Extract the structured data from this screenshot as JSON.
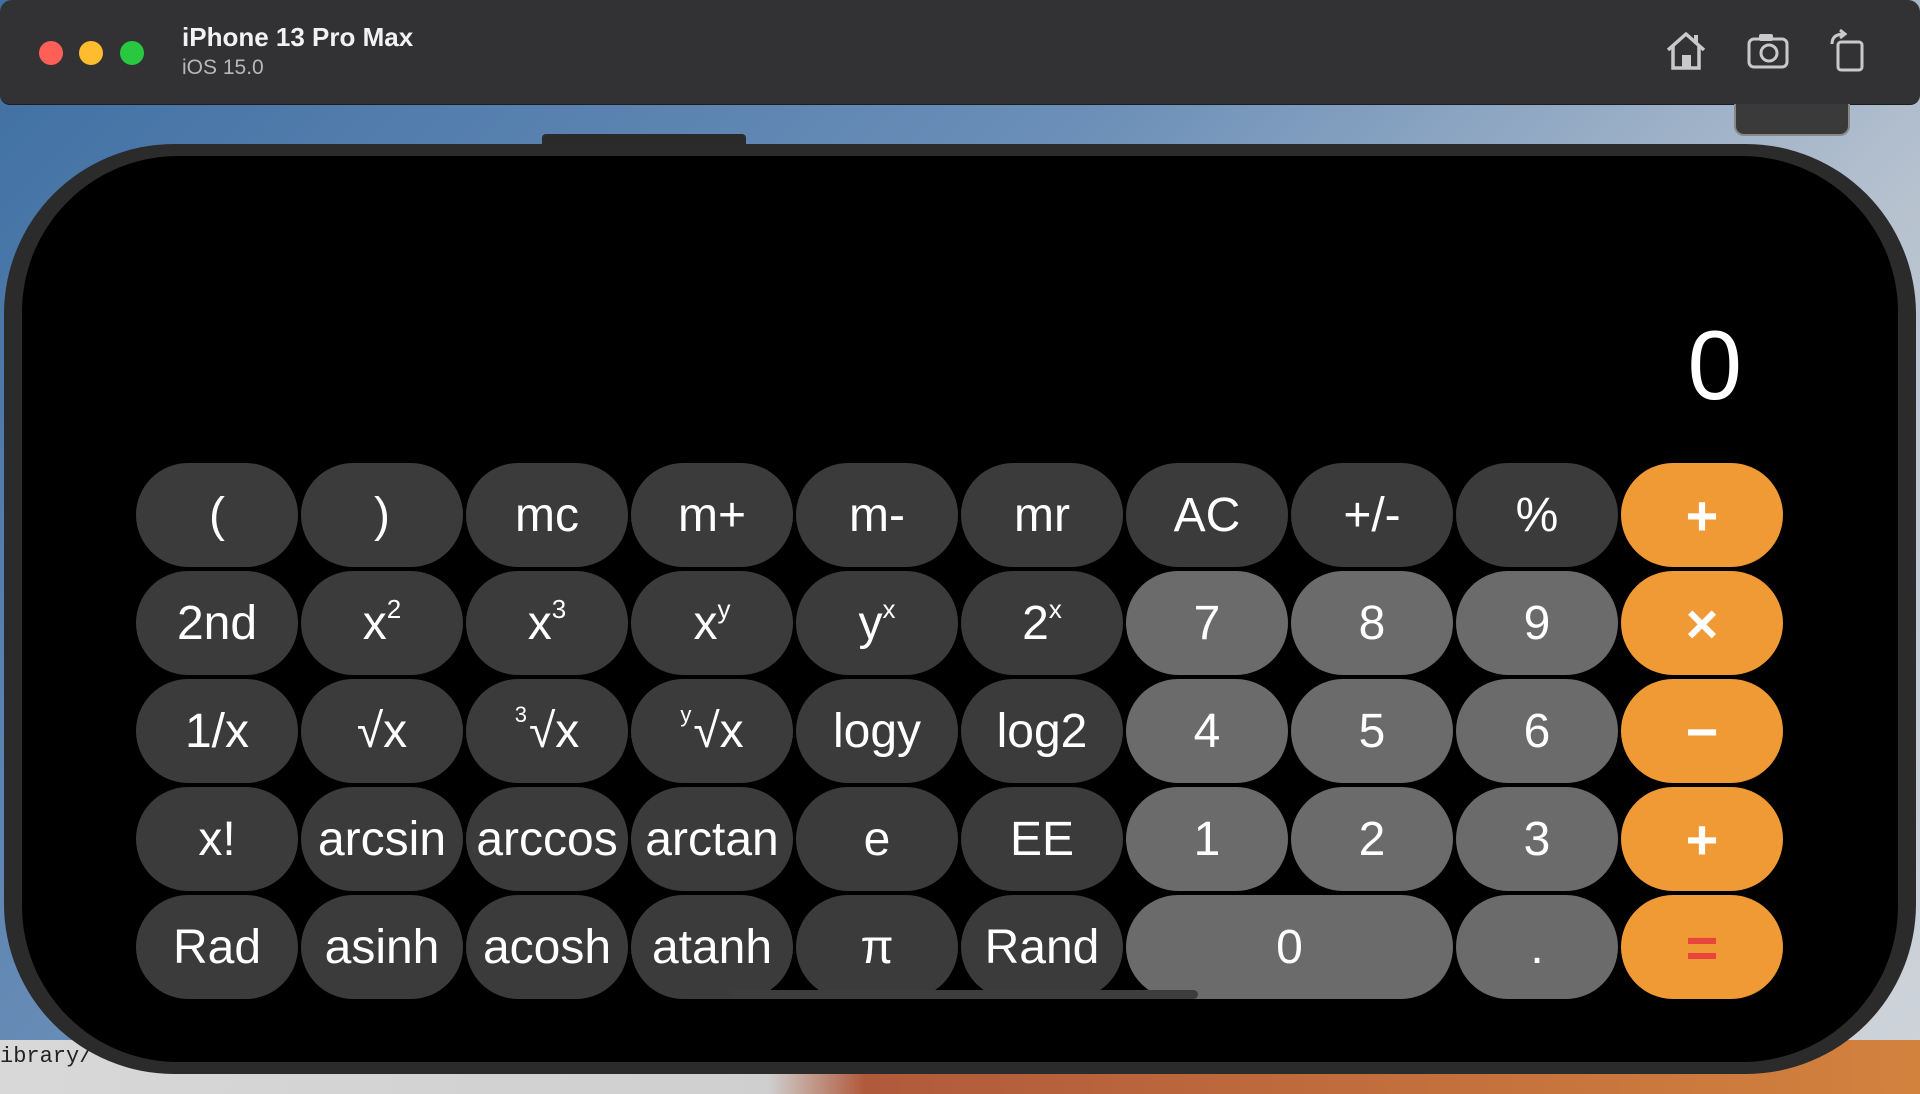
{
  "window": {
    "title": "iPhone 13 Pro Max",
    "subtitle": "iOS 15.0",
    "icons": [
      "home-icon",
      "screenshot-icon",
      "rotate-icon"
    ]
  },
  "background": {
    "terminal_text": "ibrary/"
  },
  "calculator": {
    "display": "0",
    "rows": [
      [
        "(",
        ")",
        "mc",
        "m+",
        "m-",
        "mr",
        "AC",
        "+/-",
        "%",
        "÷"
      ],
      [
        "2nd",
        "x²",
        "x³",
        "xʸ",
        "yˣ",
        "2ˣ",
        "7",
        "8",
        "9",
        "×"
      ],
      [
        "1/x",
        "√x",
        "∛x",
        "ʸ√x",
        "logy",
        "log2",
        "4",
        "5",
        "6",
        "−"
      ],
      [
        "x!",
        "arcsin",
        "arccos",
        "arctan",
        "e",
        "EE",
        "1",
        "2",
        "3",
        "+"
      ],
      [
        "Rad",
        "asinh",
        "acosh",
        "atanh",
        "π",
        "Rand",
        "0",
        ".",
        "="
      ]
    ],
    "keys": {
      "r0": [
        "(",
        ")",
        "mc",
        "m+",
        "m-",
        "mr",
        "AC",
        "+/-",
        "%",
        "+"
      ],
      "r1_base": [
        "2nd",
        "x",
        "x",
        "x",
        "y",
        "2",
        "7",
        "8",
        "9",
        "×"
      ],
      "r1_sup": [
        "",
        "2",
        "3",
        "y",
        "x",
        "x"
      ],
      "r2": [
        "1/x",
        "√x",
        "√x",
        "√x",
        "logy",
        "log2",
        "4",
        "5",
        "6",
        "−"
      ],
      "r2_pre": [
        "",
        "",
        "3",
        "y"
      ],
      "r3": [
        "x!",
        "arcsin",
        "arccos",
        "arctan",
        "e",
        "EE",
        "1",
        "2",
        "3",
        "+"
      ],
      "r4": [
        "Rad",
        "asinh",
        "acosh",
        "atanh",
        "π",
        "Rand",
        "0",
        ".",
        "="
      ]
    },
    "colors": {
      "function_key": "#3b3b3b",
      "number_key": "#6b6b6b",
      "operator_key": "#f09a36",
      "equals_glyph": "#e8453c"
    }
  }
}
